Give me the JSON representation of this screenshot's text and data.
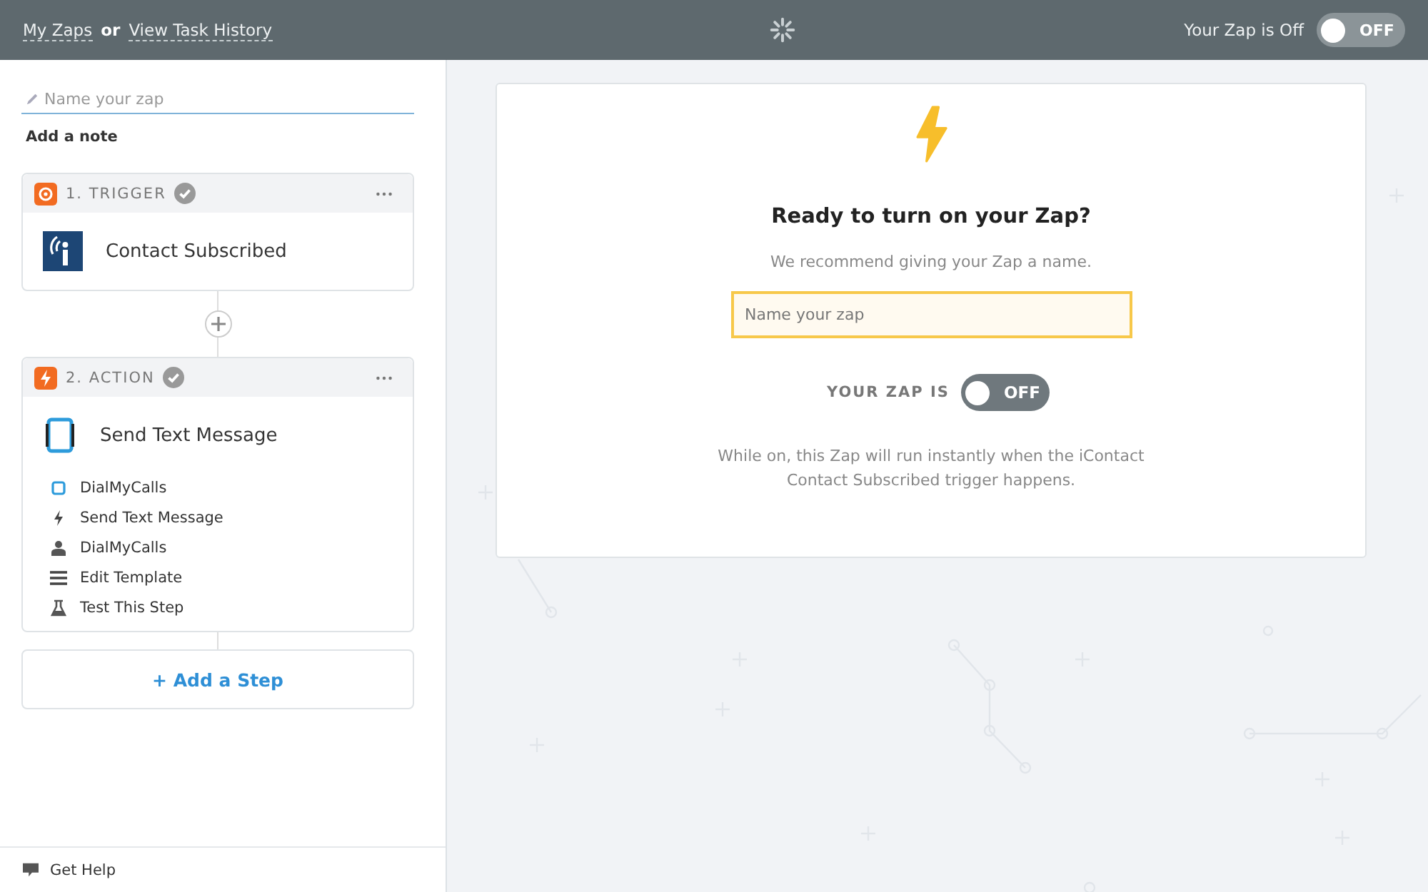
{
  "header": {
    "links": [
      {
        "label": "My Zaps"
      },
      {
        "label": "View Task History"
      }
    ],
    "separator": "or",
    "status": "Your Zap is Off",
    "toggle": {
      "on": false,
      "label": "OFF"
    }
  },
  "sidebar": {
    "name_field": {
      "placeholder": "Name your zap"
    },
    "add_note": "Add a note",
    "steps": [
      {
        "kind": "trigger",
        "label": "1. TRIGGER",
        "done": true,
        "title": "Contact Subscribed"
      },
      {
        "kind": "action",
        "label": "2. ACTION",
        "done": true,
        "title": "Send Text Message",
        "details": [
          {
            "kind": "app",
            "text": "DialMyCalls"
          },
          {
            "kind": "event",
            "text": "Send Text Message"
          },
          {
            "kind": "account",
            "text": "DialMyCalls"
          },
          {
            "kind": "template",
            "text": "Edit Template"
          },
          {
            "kind": "test",
            "text": "Test This Step"
          }
        ]
      }
    ],
    "add_step": "+ Add a Step",
    "get_help": "Get Help"
  },
  "card": {
    "title": "Ready to turn on your Zap?",
    "subtitle": "We recommend giving your Zap a name.",
    "name_field": {
      "placeholder": "Name your zap"
    },
    "toggle_label": "YOUR ZAP IS",
    "toggle": {
      "on": false,
      "label": "OFF"
    },
    "note": "While on, this Zap will run instantly when the iContact Contact Subscribed trigger happens."
  }
}
